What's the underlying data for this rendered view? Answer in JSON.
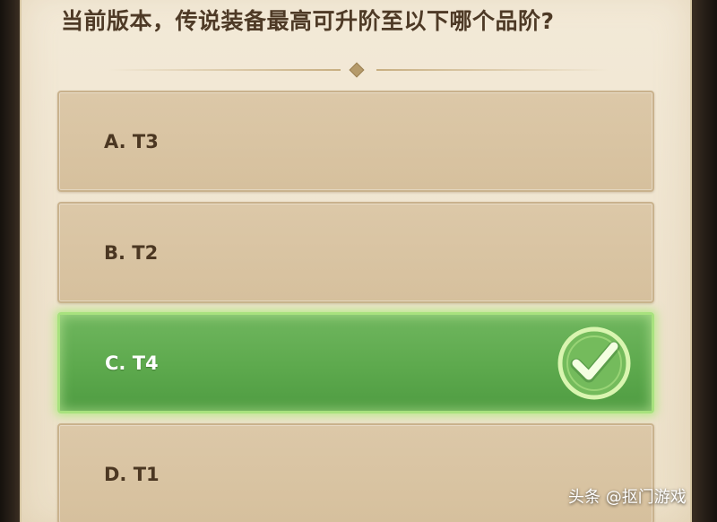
{
  "question": "当前版本，传说装备最高可升阶至以下哪个品阶?",
  "options": [
    {
      "label": "A. T3",
      "state": "default"
    },
    {
      "label": "B. T2",
      "state": "default"
    },
    {
      "label": "C. T4",
      "state": "correct"
    },
    {
      "label": "D. T1",
      "state": "default"
    }
  ],
  "correct_icon": "check-circle-icon",
  "watermark": "头条 @抠门游戏",
  "colors": {
    "panel_bg": "#efe4cf",
    "option_bg": "#d8c4a2",
    "correct_bg": "#5da94d",
    "correct_glow": "#a8e27e",
    "text": "#4b3722"
  }
}
